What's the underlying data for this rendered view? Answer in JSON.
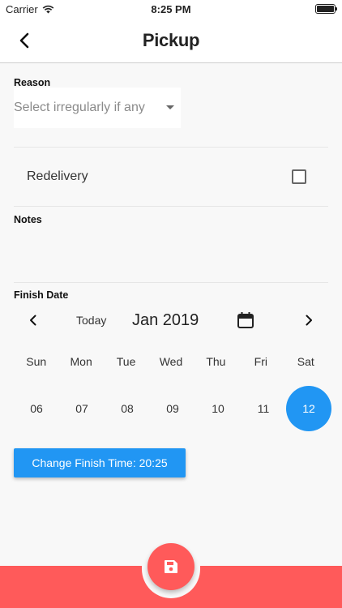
{
  "status_bar": {
    "carrier": "Carrier",
    "time": "8:25 PM"
  },
  "nav": {
    "title": "Pickup",
    "back_icon": "chevron-left-icon"
  },
  "form": {
    "reason_label": "Reason",
    "reason_placeholder": "Select irregularly if any",
    "redelivery_label": "Redelivery",
    "redelivery_checked": false,
    "notes_label": "Notes",
    "notes_value": "",
    "finish_date_label": "Finish Date"
  },
  "calendar": {
    "today_label": "Today",
    "month_label": "Jan 2019",
    "weekdays": [
      "Sun",
      "Mon",
      "Tue",
      "Wed",
      "Thu",
      "Fri",
      "Sat"
    ],
    "days": [
      "06",
      "07",
      "08",
      "09",
      "10",
      "11",
      "12"
    ],
    "selected_day": "12",
    "selected_color": "#2196f3"
  },
  "finish_time_button": "Change Finish Time: 20:25",
  "fab": {
    "icon": "save-icon",
    "color": "#ff5a5a"
  }
}
